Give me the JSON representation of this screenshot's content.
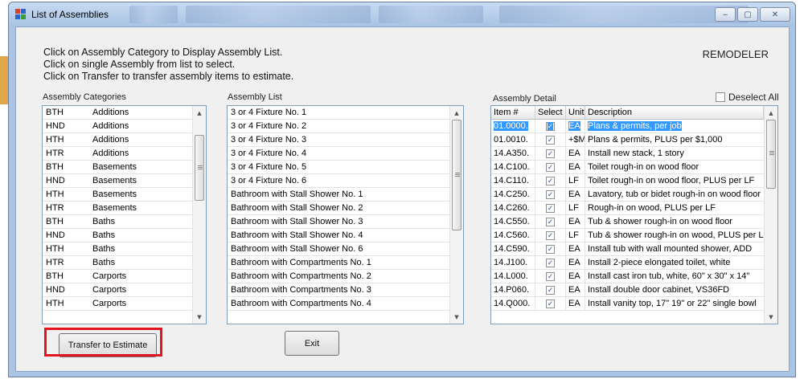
{
  "window": {
    "title": "List of Assemblies",
    "buttons": {
      "minimize": "‒",
      "maximize": "▢",
      "close": "✕"
    }
  },
  "instructions": [
    "Click on Assembly Category to Display Assembly List.",
    "Click on single Assembly from list to select.",
    "Click on Transfer to transfer assembly items to estimate."
  ],
  "mode_label": "REMODELER",
  "categories": {
    "label": "Assembly Categories",
    "rows": [
      {
        "code": "BTH",
        "name": "Additions"
      },
      {
        "code": "HND",
        "name": "Additions"
      },
      {
        "code": "HTH",
        "name": "Additions"
      },
      {
        "code": "HTR",
        "name": "Additions"
      },
      {
        "code": "BTH",
        "name": "Basements"
      },
      {
        "code": "HND",
        "name": "Basements"
      },
      {
        "code": "HTH",
        "name": "Basements"
      },
      {
        "code": "HTR",
        "name": "Basements"
      },
      {
        "code": "BTH",
        "name": "Baths"
      },
      {
        "code": "HND",
        "name": "Baths"
      },
      {
        "code": "HTH",
        "name": "Baths"
      },
      {
        "code": "HTR",
        "name": "Baths"
      },
      {
        "code": "BTH",
        "name": "Carports"
      },
      {
        "code": "HND",
        "name": "Carports"
      },
      {
        "code": "HTH",
        "name": "Carports"
      }
    ]
  },
  "assemblies": {
    "label": "Assembly List",
    "rows": [
      "3 or 4 Fixture No. 1",
      "3 or 4 Fixture No. 2",
      "3 or 4 Fixture No. 3",
      "3 or 4 Fixture No. 4",
      "3 or 4 Fixture No. 5",
      "3 or 4 Fixture No. 6",
      "Bathroom with Stall Shower No. 1",
      "Bathroom with Stall Shower No. 2",
      "Bathroom with Stall Shower No. 3",
      "Bathroom with Stall Shower No. 4",
      "Bathroom with Stall Shower No. 6",
      "Bathroom with Compartments No. 1",
      "Bathroom with Compartments No. 2",
      "Bathroom with Compartments No. 3",
      "Bathroom with Compartments No. 4"
    ]
  },
  "detail": {
    "label": "Assembly Detail",
    "deselect_all": "Deselect All",
    "columns": [
      "Item #",
      "Select",
      "Unit",
      "Description"
    ],
    "check_mark": "✓",
    "rows": [
      {
        "item": "01.0000.",
        "selected": true,
        "unit": "EA",
        "desc": "Plans & permits, per job"
      },
      {
        "item": "01.0010.",
        "selected": true,
        "unit": "+$M",
        "desc": "Plans & permits, PLUS per $1,000"
      },
      {
        "item": "14.A350.",
        "selected": true,
        "unit": "EA",
        "desc": "Install new stack, 1 story"
      },
      {
        "item": "14.C100.",
        "selected": true,
        "unit": "EA",
        "desc": "Toilet rough-in on wood floor"
      },
      {
        "item": "14.C110.",
        "selected": true,
        "unit": "LF",
        "desc": "Toilet rough-in on wood floor, PLUS per LF"
      },
      {
        "item": "14.C250.",
        "selected": true,
        "unit": "EA",
        "desc": "Lavatory, tub or bidet rough-in on wood floor"
      },
      {
        "item": "14.C260.",
        "selected": true,
        "unit": "LF",
        "desc": "Rough-in on wood, PLUS per LF"
      },
      {
        "item": "14.C550.",
        "selected": true,
        "unit": "EA",
        "desc": "Tub & shower rough-in on wood floor"
      },
      {
        "item": "14.C560.",
        "selected": true,
        "unit": "LF",
        "desc": "Tub & shower rough-in on wood, PLUS per LF"
      },
      {
        "item": "14.C590.",
        "selected": true,
        "unit": "EA",
        "desc": "Install tub with wall mounted shower, ADD"
      },
      {
        "item": "14.J100.",
        "selected": true,
        "unit": "EA",
        "desc": "Install 2-piece elongated toilet, white"
      },
      {
        "item": "14.L000.",
        "selected": true,
        "unit": "EA",
        "desc": "Install cast iron tub, white, 60\" x 30\" x 14\""
      },
      {
        "item": "14.P060.",
        "selected": true,
        "unit": "EA",
        "desc": "Install double door cabinet, VS36FD"
      },
      {
        "item": "14.Q000.",
        "selected": true,
        "unit": "EA",
        "desc": "Install vanity top, 17\" 19\" or 22\" single bowl"
      }
    ]
  },
  "buttons": {
    "transfer": "Transfer to Estimate",
    "exit": "Exit"
  },
  "colors": {
    "highlight": "#e3141d",
    "selection": "#3399ff"
  }
}
